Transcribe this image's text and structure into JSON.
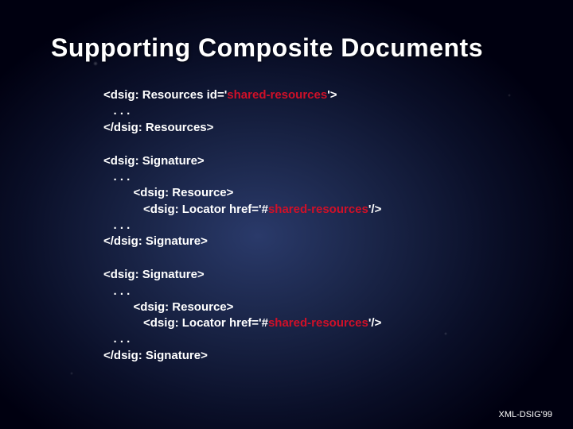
{
  "title": "Supporting Composite Documents",
  "blocks": {
    "b1": {
      "l1a": "<dsig: Resources id='",
      "l1b": "shared-resources",
      "l1c": "'>",
      "l2": "   . . .",
      "l3": "</dsig: Resources>"
    },
    "b2": {
      "l1": "<dsig: Signature>",
      "l2": "   . . .",
      "l3": "         <dsig: Resource>",
      "l4a": "            <dsig: Locator href='#",
      "l4b": "shared-resources",
      "l4c": "'/>",
      "l5": "   . . .",
      "l6": "</dsig: Signature>"
    },
    "b3": {
      "l1": "<dsig: Signature>",
      "l2": "   . . .",
      "l3": "         <dsig: Resource>",
      "l4a": "            <dsig: Locator href='#",
      "l4b": "shared-resources",
      "l4c": "'/>",
      "l5": "   . . .",
      "l6": "</dsig: Signature>"
    }
  },
  "footer": "XML-DSIG'99"
}
